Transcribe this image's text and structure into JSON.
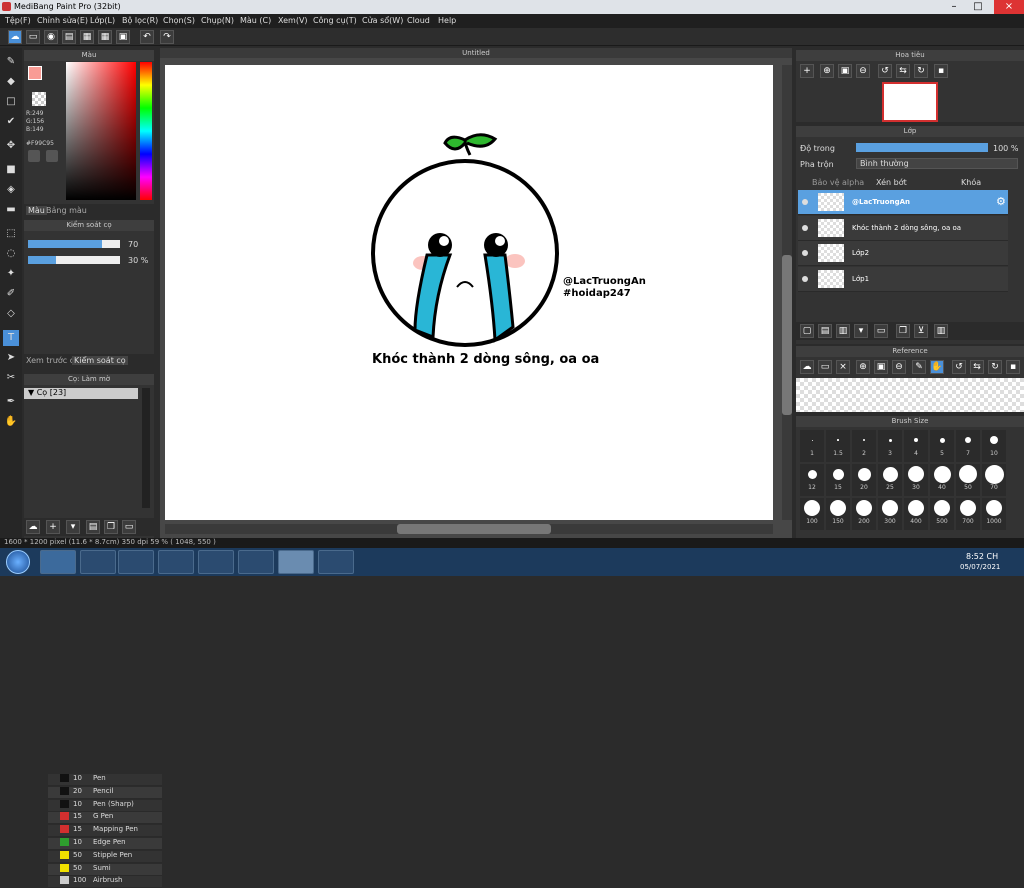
{
  "app": {
    "title": "MediBang Paint Pro (32bit)",
    "doc_tab": "Untitled"
  },
  "menu": [
    "Tệp(F)",
    "Chỉnh sửa(E)",
    "Lớp(L)",
    "Bộ lọc(R)",
    "Chọn(S)",
    "Chụp(N)",
    "Màu (C)",
    "Xem(V)",
    "Công cụ(T)",
    "Cửa sổ(W)",
    "Cloud",
    "Help"
  ],
  "color_panel": {
    "title": "Màu",
    "r": "R:249",
    "g": "G:156",
    "b": "B:149",
    "hex": "#F99C95",
    "tab1": "Màu",
    "tab2": "Bảng màu"
  },
  "brush_control": {
    "title": "Kiểm soát cọ",
    "size": "70",
    "opacity": "30 %",
    "tab1": "Xem trước cọ",
    "tab2": "Kiểm soát cọ"
  },
  "brush_list": {
    "title": "Cọ: Làm mờ",
    "group": "Cọ [23]",
    "items": [
      {
        "size": "10",
        "name": "Pen",
        "color": "#111111"
      },
      {
        "size": "20",
        "name": "Pencil",
        "color": "#111111"
      },
      {
        "size": "10",
        "name": "Pen (Sharp)",
        "color": "#111111"
      },
      {
        "size": "15",
        "name": "G Pen",
        "color": "#d32f2f"
      },
      {
        "size": "15",
        "name": "Mapping Pen",
        "color": "#d32f2f"
      },
      {
        "size": "10",
        "name": "Edge Pen",
        "color": "#2e9e2e"
      },
      {
        "size": "50",
        "name": "Stipple Pen",
        "color": "#f0e000"
      },
      {
        "size": "50",
        "name": "Sumi",
        "color": "#f0e000"
      },
      {
        "size": "100",
        "name": "Airbrush",
        "color": "#cccccc"
      }
    ]
  },
  "artwork": {
    "handle": "@LacTruongAn",
    "tag": "#hoidap247",
    "caption": "Khóc thành 2 dòng sông, oa oa"
  },
  "navigator": {
    "title": "Hoa tiêu"
  },
  "layer_panel": {
    "title": "Lớp",
    "opacity_label": "Độ trong",
    "opacity_value": "100 %",
    "blend_label": "Pha trộn",
    "blend_value": "Bình thường",
    "protect_alpha": "Bảo vệ alpha",
    "clip": "Xén bớt",
    "lock": "Khóa",
    "layers": [
      {
        "name": "@LacTruongAn"
      },
      {
        "name": "Khóc thành 2 dòng sông, oa oa"
      },
      {
        "name": "Lớp2"
      },
      {
        "name": "Lớp1"
      }
    ]
  },
  "reference": {
    "title": "Reference"
  },
  "brush_size": {
    "title": "Brush Size",
    "sizes": [
      "1",
      "1.5",
      "2",
      "3",
      "4",
      "5",
      "7",
      "10",
      "12",
      "15",
      "20",
      "25",
      "30",
      "40",
      "50",
      "70",
      "100",
      "150",
      "200",
      "300",
      "400",
      "500",
      "700",
      "1000"
    ]
  },
  "status": {
    "text": "1600 * 1200 pixel  (11.6 * 8.7cm)  350 dpi  59 %  ( 1048, 550 )"
  },
  "taskbar": {
    "time": "8:52 CH",
    "date": "05/07/2021"
  }
}
